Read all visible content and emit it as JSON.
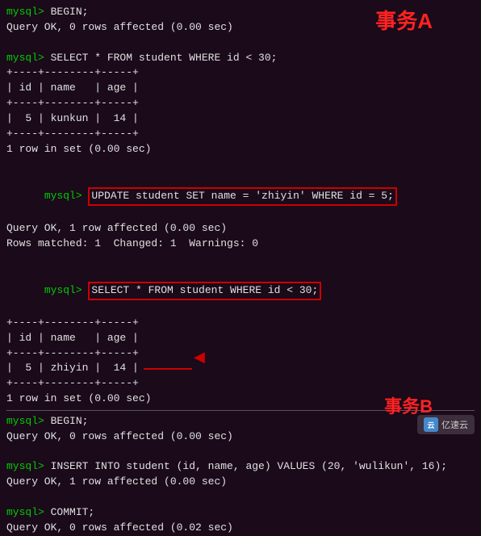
{
  "terminal": {
    "section_a_label": "事务A",
    "section_b_label": "事务B",
    "watermark_text": "亿速云",
    "lines_top": [
      {
        "type": "prompt_cmd",
        "prompt": "mysql> ",
        "cmd": "BEGIN;"
      },
      {
        "type": "result",
        "text": "Query OK, 0 rows affected (0.00 sec)"
      },
      {
        "type": "blank"
      },
      {
        "type": "prompt_cmd",
        "prompt": "mysql> ",
        "cmd": "SELECT * FROM student WHERE id < 30;"
      },
      {
        "type": "table_border",
        "text": "+----+--------+-----+"
      },
      {
        "type": "table_header",
        "text": "| id | name   | age |"
      },
      {
        "type": "table_border",
        "text": "+----+--------+-----+"
      },
      {
        "type": "table_row",
        "text": "|  5 | kunkun |  14 |"
      },
      {
        "type": "table_border",
        "text": "+----+--------+-----+"
      },
      {
        "type": "result",
        "text": "1 row in set (0.00 sec)"
      },
      {
        "type": "blank"
      },
      {
        "type": "prompt_box",
        "prompt": "mysql> ",
        "cmd": "UPDATE student SET name = 'zhiyin' WHERE id = 5;"
      },
      {
        "type": "result",
        "text": "Query OK, 1 row affected (0.00 sec)"
      },
      {
        "type": "result",
        "text": "Rows matched: 1  Changed: 1  Warnings: 0"
      },
      {
        "type": "blank"
      },
      {
        "type": "prompt_box",
        "prompt": "mysql> ",
        "cmd": "SELECT * FROM student WHERE id < 30;"
      },
      {
        "type": "table_border",
        "text": "+----+--------+-----+"
      },
      {
        "type": "table_header",
        "text": "| id | name   | age |"
      },
      {
        "type": "table_border",
        "text": "+----+--------+-----+"
      },
      {
        "type": "table_row_arrow",
        "text": "|  5 | zhiyin |  14 |"
      },
      {
        "type": "table_border",
        "text": "+----+--------+-----+"
      },
      {
        "type": "result",
        "text": "1 row in set (0.00 sec)"
      }
    ],
    "lines_bottom": [
      {
        "type": "prompt_cmd",
        "prompt": "mysql> ",
        "cmd": "BEGIN;"
      },
      {
        "type": "result",
        "text": "Query OK, 0 rows affected (0.00 sec)"
      },
      {
        "type": "blank"
      },
      {
        "type": "prompt_cmd",
        "prompt": "mysql> ",
        "cmd": "INSERT INTO student (id, name, age) VALUES (20, 'wulikun', 16);"
      },
      {
        "type": "result",
        "text": "Query OK, 1 row affected (0.00 sec)"
      },
      {
        "type": "blank"
      },
      {
        "type": "prompt_cmd",
        "prompt": "mysql> ",
        "cmd": "COMMIT;"
      },
      {
        "type": "result",
        "text": "Query OK, 0 rows affected (0.02 sec)"
      }
    ]
  }
}
